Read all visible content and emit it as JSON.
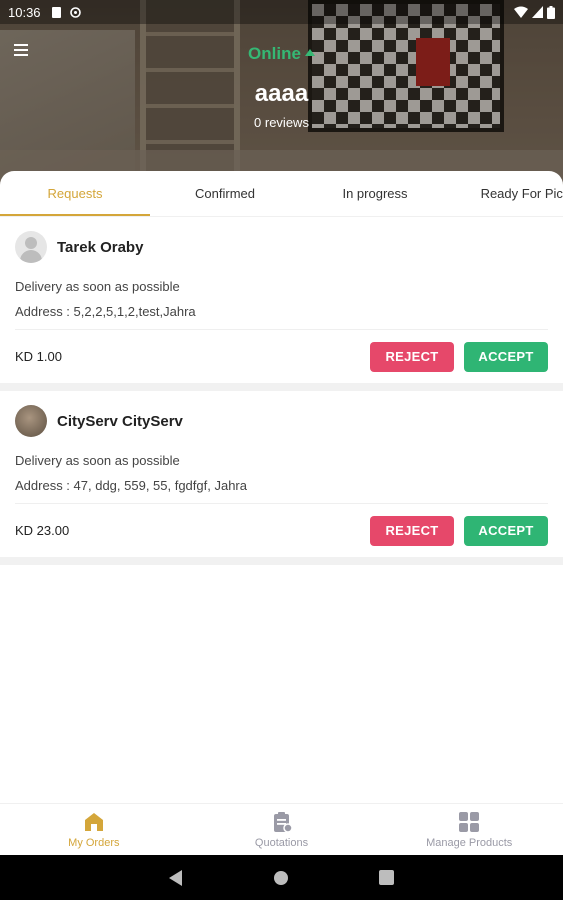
{
  "status_bar": {
    "time": "10:36"
  },
  "header": {
    "menu_icon": "hamburger-menu-icon",
    "availability": "Online",
    "availability_color": "#35b874",
    "shop_name": "aaaa",
    "reviews": "0 reviews"
  },
  "tabs": [
    {
      "label": "Requests",
      "active": true
    },
    {
      "label": "Confirmed",
      "active": false
    },
    {
      "label": "In progress",
      "active": false
    },
    {
      "label": "Ready For Pick"
    }
  ],
  "orders": [
    {
      "customer": "Tarek Oraby",
      "delivery": "Delivery as soon as possible",
      "address": "Address : 5,2,2,5,1,2,test,Jahra",
      "price": "KD 1.00",
      "reject_label": "REJECT",
      "accept_label": "ACCEPT"
    },
    {
      "customer": "CityServ CityServ",
      "delivery": "Delivery as soon as possible",
      "address": "Address : 47, ddg, 559, 55, fgdfgf, Jahra",
      "price": "KD 23.00",
      "reject_label": "REJECT",
      "accept_label": "ACCEPT"
    }
  ],
  "bottom_nav": [
    {
      "label": "My Orders",
      "icon": "home-icon",
      "active": true
    },
    {
      "label": "Quotations",
      "icon": "clipboard-icon",
      "active": false
    },
    {
      "label": "Manage Products",
      "icon": "grid-icon",
      "active": false
    }
  ],
  "colors": {
    "accent": "#d4a63a",
    "reject": "#e6486a",
    "accept": "#2fb574"
  }
}
